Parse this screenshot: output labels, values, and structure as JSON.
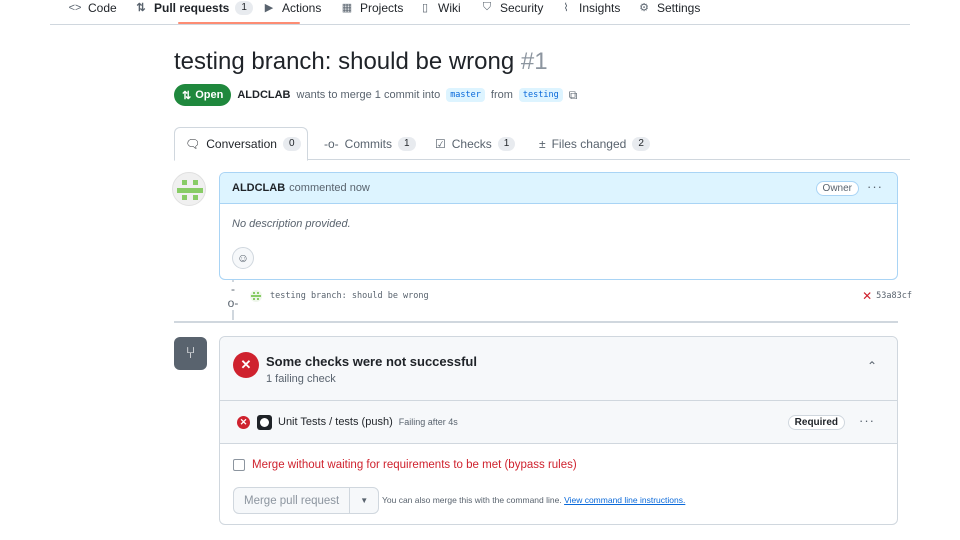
{
  "repo_nav": {
    "items": [
      {
        "icon": "code-icon",
        "glyph": "<>",
        "label": "Code"
      },
      {
        "icon": "pull-request-icon",
        "glyph": "⇅",
        "label": "Pull requests",
        "count": "1"
      },
      {
        "icon": "play-icon",
        "glyph": "▶",
        "label": "Actions"
      },
      {
        "icon": "table-icon",
        "glyph": "▦",
        "label": "Projects"
      },
      {
        "icon": "book-icon",
        "glyph": "▯",
        "label": "Wiki"
      },
      {
        "icon": "shield-icon",
        "glyph": "⛉",
        "label": "Security"
      },
      {
        "icon": "graph-icon",
        "glyph": "⌇",
        "label": "Insights"
      },
      {
        "icon": "gear-icon",
        "glyph": "⚙",
        "label": "Settings"
      }
    ]
  },
  "pr": {
    "title": "testing branch: should be wrong",
    "number": "#1",
    "state": "Open",
    "author": "ALDCLAB",
    "merge_text_1": "wants to merge 1 commit into",
    "base_branch": "master",
    "merge_text_2": "from",
    "head_branch": "testing"
  },
  "tabs": [
    {
      "icon": "comment-icon",
      "glyph": "🗨",
      "label": "Conversation",
      "count": "0"
    },
    {
      "icon": "commit-icon",
      "glyph": "-o-",
      "label": "Commits",
      "count": "1"
    },
    {
      "icon": "checklist-icon",
      "glyph": "☑",
      "label": "Checks",
      "count": "1"
    },
    {
      "icon": "file-diff-icon",
      "glyph": "±",
      "label": "Files changed",
      "count": "2"
    }
  ],
  "comment": {
    "author": "ALDCLAB",
    "action": "commented now",
    "role_badge": "Owner",
    "body": "No description provided."
  },
  "commit": {
    "message": "testing branch: should be wrong",
    "sha": "53a83cf"
  },
  "checks": {
    "title": "Some checks were not successful",
    "subtitle": "1 failing check",
    "item_name": "Unit Tests / tests (push)",
    "item_status": "Failing after 4s",
    "required_badge": "Required"
  },
  "merge": {
    "bypass_label": "Merge without waiting for requirements to be met (bypass rules)",
    "button_label": "Merge pull request",
    "hint_text": "You can also merge this with the command line.",
    "hint_link": "View command line instructions."
  },
  "colors": {
    "open_green": "#1f883d",
    "fail_red": "#cf222e",
    "link_blue": "#0969da",
    "nav_underline": "#fd8c73"
  }
}
